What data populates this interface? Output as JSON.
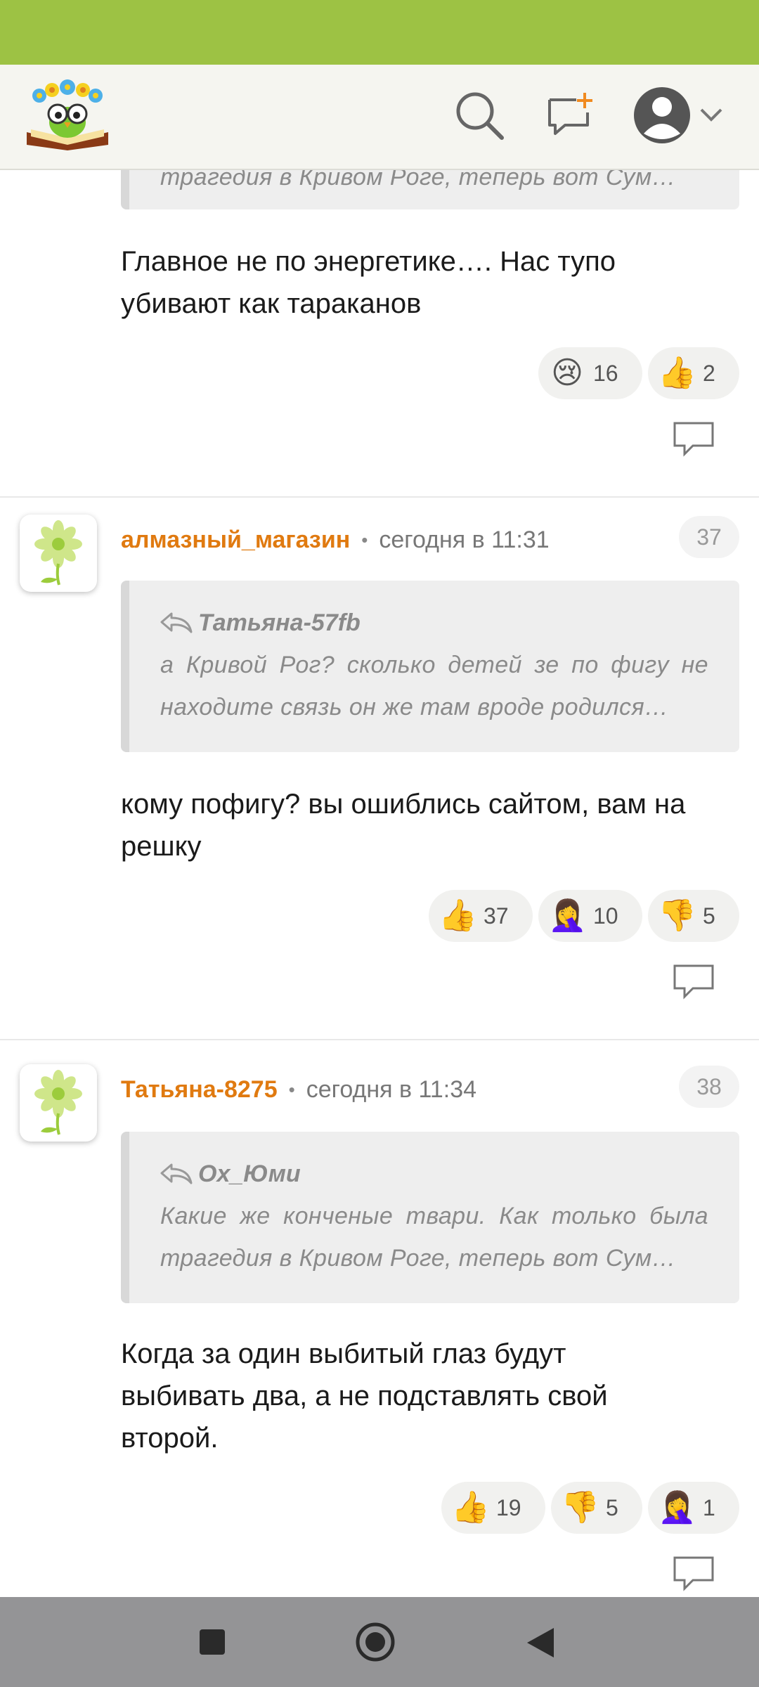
{
  "header": {
    "logo_icon": "owl-book-logo",
    "search_icon": "search-icon",
    "new_message_icon": "chat-add-icon",
    "profile_icon": "user-avatar-icon",
    "accent_color": "#9dc244"
  },
  "top_comment": {
    "quote_tail": "трагедия в Кривом Роге, теперь вот Сум…",
    "text": "Главное не по энергетике…. Нас тупо убивают как тараканов",
    "reactions": [
      {
        "emoji": "😢",
        "count": "16"
      },
      {
        "emoji": "👍",
        "count": "2"
      }
    ]
  },
  "comments": [
    {
      "number": "37",
      "author": "алмазный_магазин",
      "time": "сегодня в 11:31",
      "quote_author": "Татьяна-57fb",
      "quote_text": "а Кривой Рог? сколько детей зе по фигу не находите связь он же там вроде родился…",
      "text": "кому пофигу? вы ошиблись сайтом, вам на решку",
      "reactions": [
        {
          "emoji": "👍",
          "count": "37"
        },
        {
          "emoji": "🤦‍♀️",
          "count": "10"
        },
        {
          "emoji": "👎",
          "count": "5"
        }
      ]
    },
    {
      "number": "38",
      "author": "Татьяна-8275",
      "time": "сегодня в 11:34",
      "quote_author": "Ох_Юми",
      "quote_text": "Какие же конченые твари. Как только была трагедия в Кривом Роге, теперь вот Сум…",
      "text": "Когда за один выбитый глаз будут выбивать два, а не подставлять свой второй.",
      "reactions": [
        {
          "emoji": "👍",
          "count": "19"
        },
        {
          "emoji": "👎",
          "count": "5"
        },
        {
          "emoji": "🤦‍♀️",
          "count": "1"
        }
      ]
    }
  ],
  "nav": {
    "buttons": [
      "square-icon",
      "home-circle-icon",
      "back-triangle-icon"
    ]
  }
}
